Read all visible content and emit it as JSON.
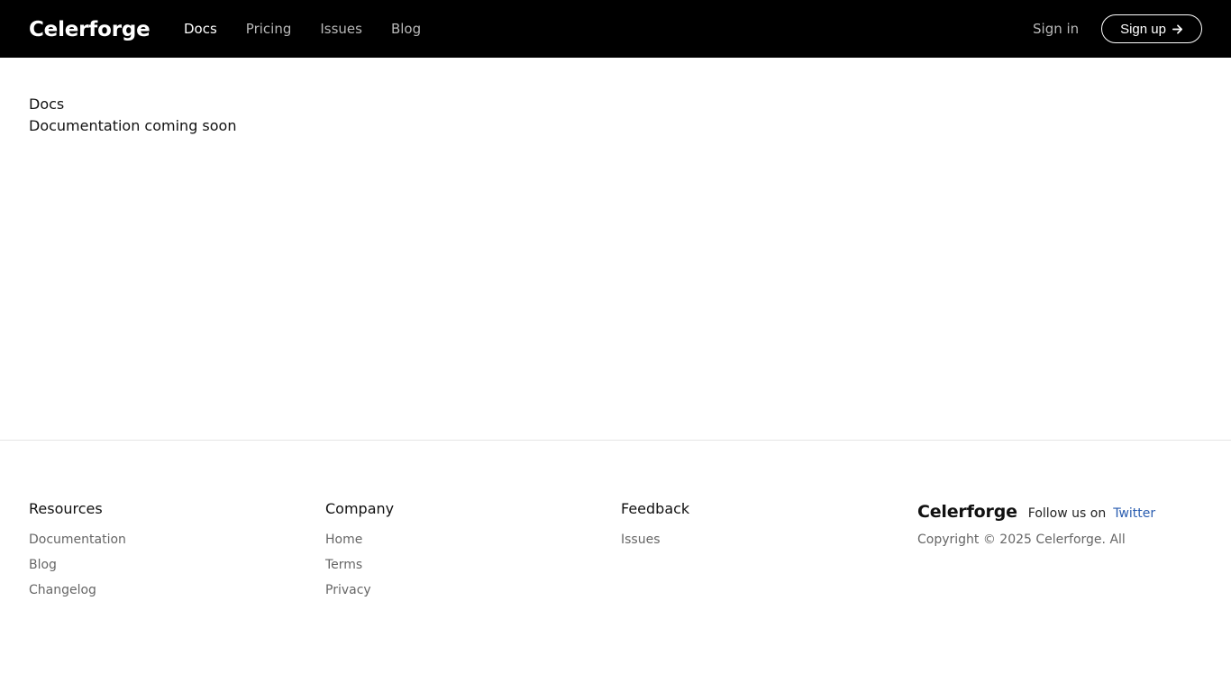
{
  "header": {
    "logo": "Celerforge",
    "nav": [
      {
        "label": "Docs",
        "active": true
      },
      {
        "label": "Pricing",
        "active": false
      },
      {
        "label": "Issues",
        "active": false
      },
      {
        "label": "Blog",
        "active": false
      }
    ],
    "signin_label": "Sign in",
    "signup_label": "Sign up",
    "signup_icon": "arrow-right-icon"
  },
  "main": {
    "title": "Docs",
    "subtitle": "Documentation coming soon"
  },
  "footer": {
    "resources": {
      "heading": "Resources",
      "links": [
        "Documentation",
        "Blog",
        "Changelog"
      ]
    },
    "company": {
      "heading": "Company",
      "links": [
        "Home",
        "Terms",
        "Privacy"
      ]
    },
    "feedback": {
      "heading": "Feedback",
      "links": [
        "Issues"
      ]
    },
    "brand": {
      "logo": "Celerforge",
      "follow_text": "Follow us on",
      "twitter_label": "Twitter",
      "copyright": "Copyright © 2025 Celerforge. All"
    }
  },
  "colors": {
    "header_bg": "#000000",
    "link": "#2a5db0"
  }
}
